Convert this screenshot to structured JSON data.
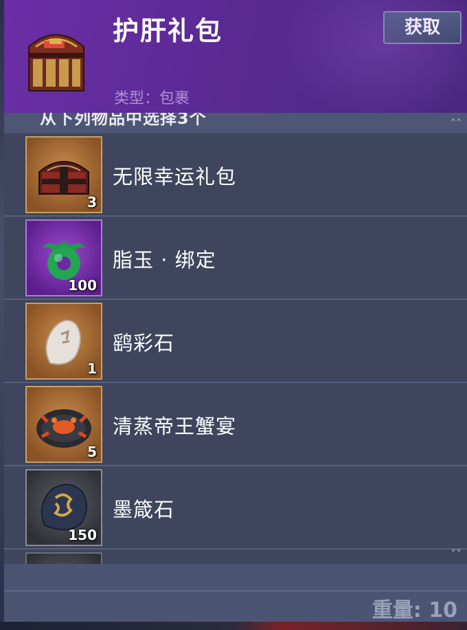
{
  "header": {
    "title": "护肝礼包",
    "get_button": "获取",
    "type_line": "类型：包裹",
    "icon": "treasure-chest-icon"
  },
  "selection": {
    "instruction": "从下列物品中选择3个",
    "scroll_up_icon": "double-chevron-up-icon",
    "scroll_down_icon": "double-chevron-down-icon"
  },
  "items": [
    {
      "name": "无限幸运礼包",
      "qty": "3",
      "icon": "gift-box-icon",
      "frame": "orange"
    },
    {
      "name": "脂玉 · 绑定",
      "qty": "100",
      "icon": "jade-ring-icon",
      "frame": "purple"
    },
    {
      "name": "鹞彩石",
      "qty": "1",
      "icon": "white-stone-icon",
      "frame": "orange"
    },
    {
      "name": "清蒸帝王蟹宴",
      "qty": "5",
      "icon": "crab-feast-icon",
      "frame": "orange"
    },
    {
      "name": "墨箴石",
      "qty": "150",
      "icon": "dragon-stone-icon",
      "frame": "grey"
    }
  ],
  "footer": {
    "weight_label": "重量: 10"
  },
  "colors": {
    "header_purple": "#5b2a94",
    "panel": "#3e455d",
    "orange_frame": "#c7a065",
    "purple_frame": "#b07ad8"
  }
}
